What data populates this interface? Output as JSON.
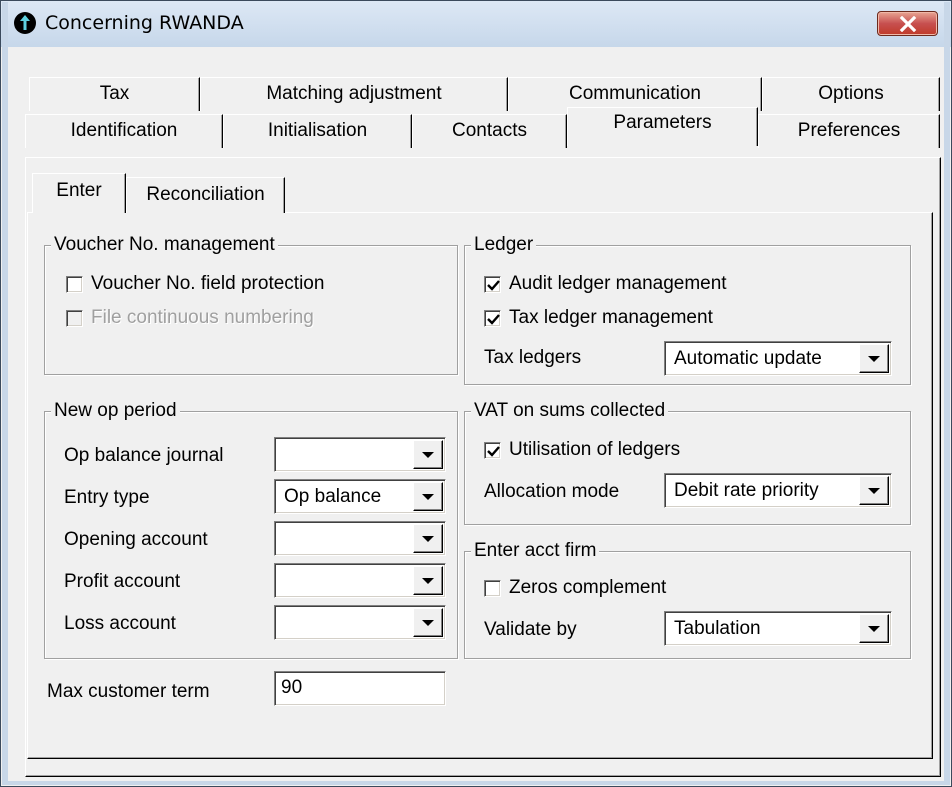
{
  "window": {
    "title": "Concerning RWANDA"
  },
  "tabs_row1": [
    "Tax",
    "Matching adjustment",
    "Communication",
    "Options"
  ],
  "tabs_row2": [
    "Identification",
    "Initialisation",
    "Contacts",
    "Parameters",
    "Preferences"
  ],
  "subtabs": [
    "Enter",
    "Reconciliation"
  ],
  "voucher": {
    "title": "Voucher No. management",
    "protection": "Voucher No. field protection",
    "continuous": "File continuous numbering"
  },
  "ledger": {
    "title": "Ledger",
    "audit": "Audit ledger management",
    "tax": "Tax ledger management",
    "tax_ledgers_label": "Tax ledgers",
    "tax_ledgers_value": "Automatic update"
  },
  "new_op": {
    "title": "New op period",
    "journal_label": "Op balance journal",
    "journal_value": "",
    "entry_label": "Entry type",
    "entry_value": "Op balance",
    "opening_label": "Opening account",
    "opening_value": "",
    "profit_label": "Profit account",
    "profit_value": "",
    "loss_label": "Loss account",
    "loss_value": ""
  },
  "vat": {
    "title": "VAT on sums collected",
    "utilisation": "Utilisation of ledgers",
    "allocation_label": "Allocation mode",
    "allocation_value": "Debit rate priority"
  },
  "acct": {
    "title": "Enter acct firm",
    "zeros": "Zeros complement",
    "validate_label": "Validate by",
    "validate_value": "Tabulation"
  },
  "max_term": {
    "label": "Max customer term",
    "value": "90"
  }
}
